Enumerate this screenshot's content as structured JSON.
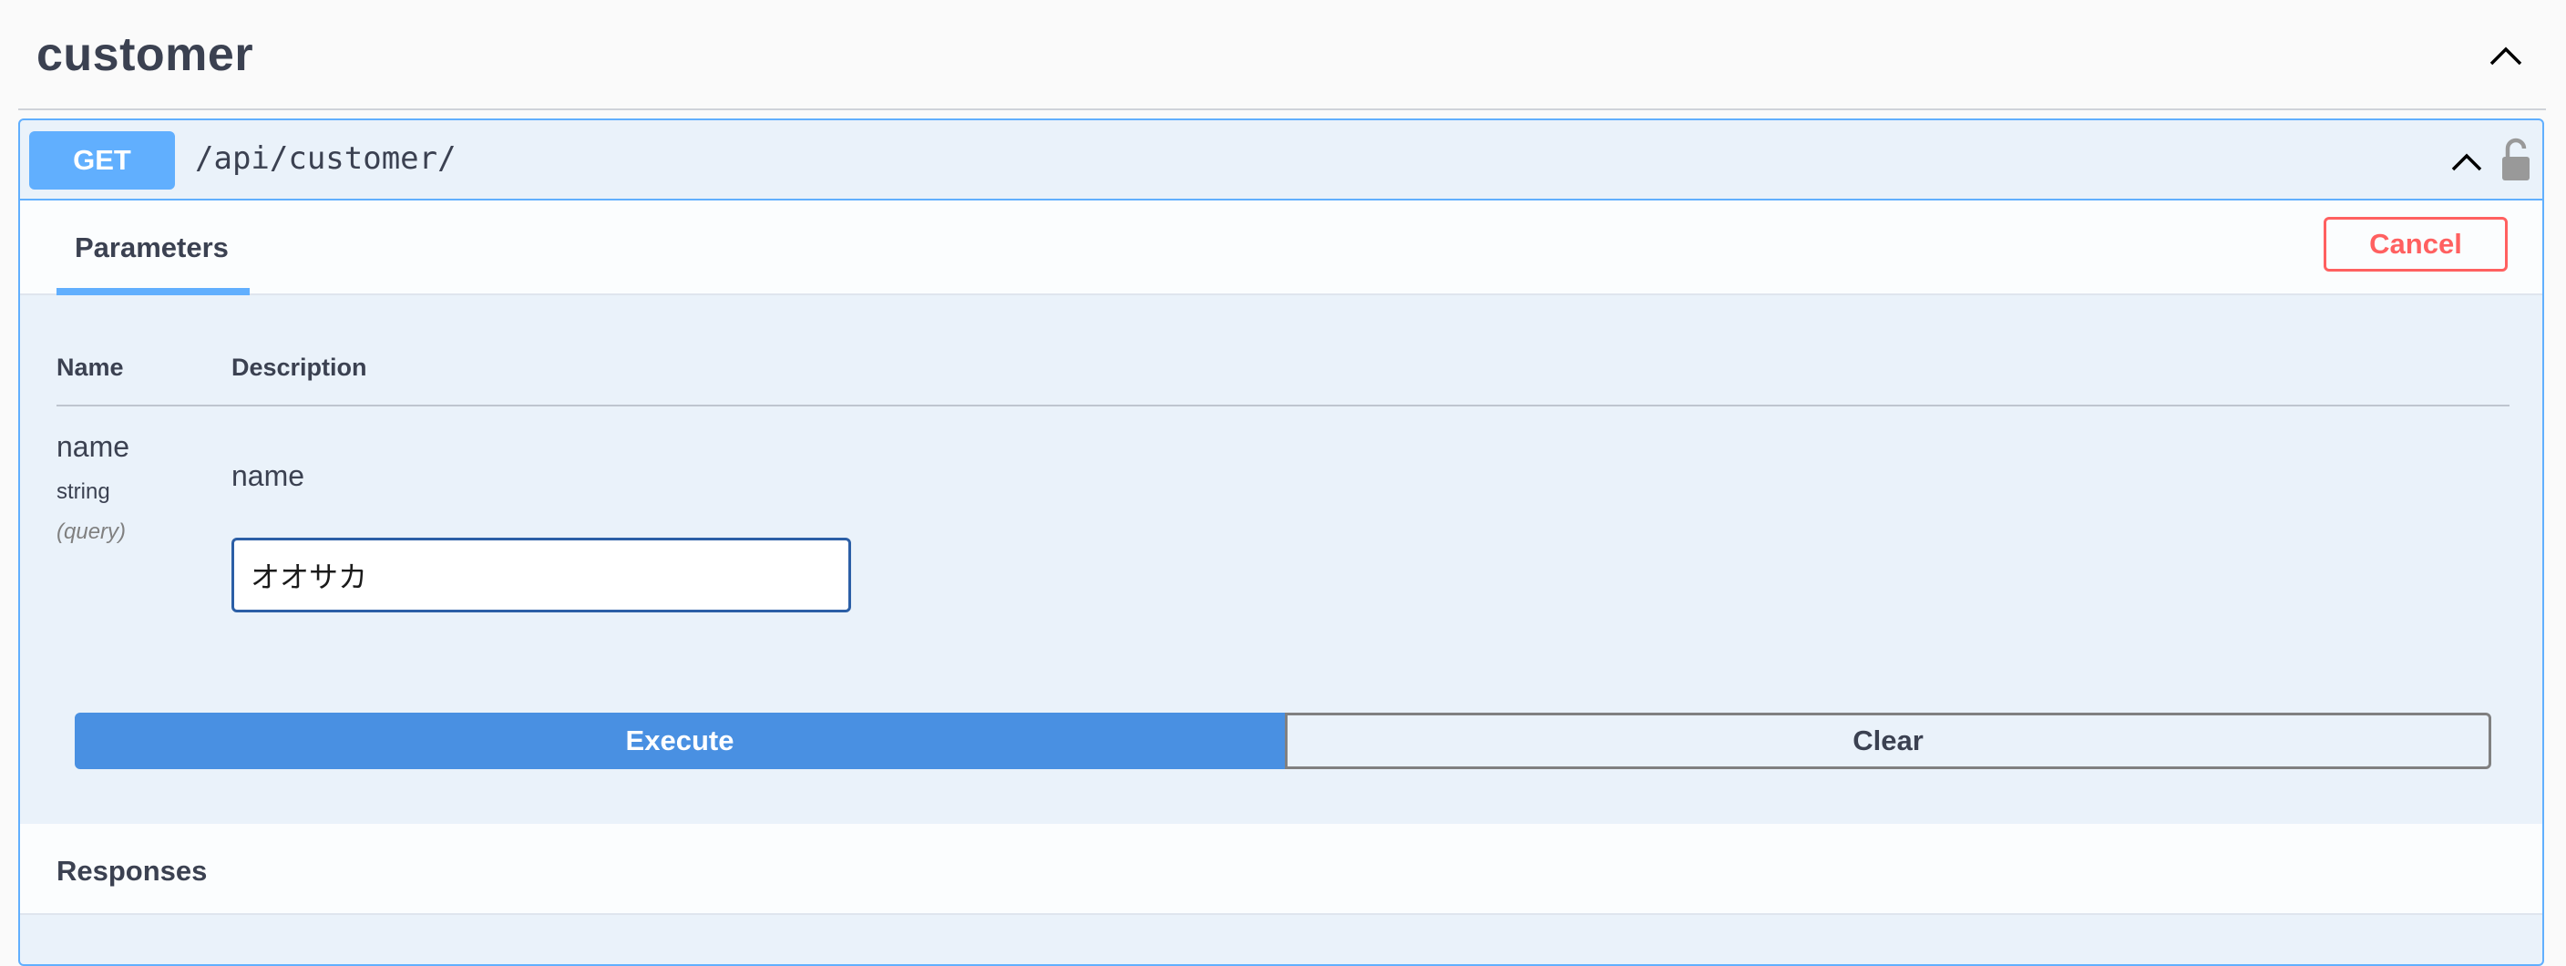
{
  "tag": {
    "title": "customer",
    "toggle_icon": "chevron-up-icon"
  },
  "operation": {
    "method": "GET",
    "path": "/api/customer/",
    "collapse_icon": "chevron-up-icon",
    "lock_icon": "unlocked-icon",
    "colors": {
      "get": "#61affe",
      "execute": "#4990e2",
      "cancel": "#ff6060"
    }
  },
  "parameters_section": {
    "tab_label": "Parameters",
    "cancel_label": "Cancel",
    "columns": [
      "Name",
      "Description"
    ],
    "params": [
      {
        "name": "name",
        "type": "string",
        "in": "(query)",
        "description": "name",
        "value": "オオサカ"
      }
    ],
    "execute_label": "Execute",
    "clear_label": "Clear"
  },
  "responses_section": {
    "title": "Responses"
  }
}
